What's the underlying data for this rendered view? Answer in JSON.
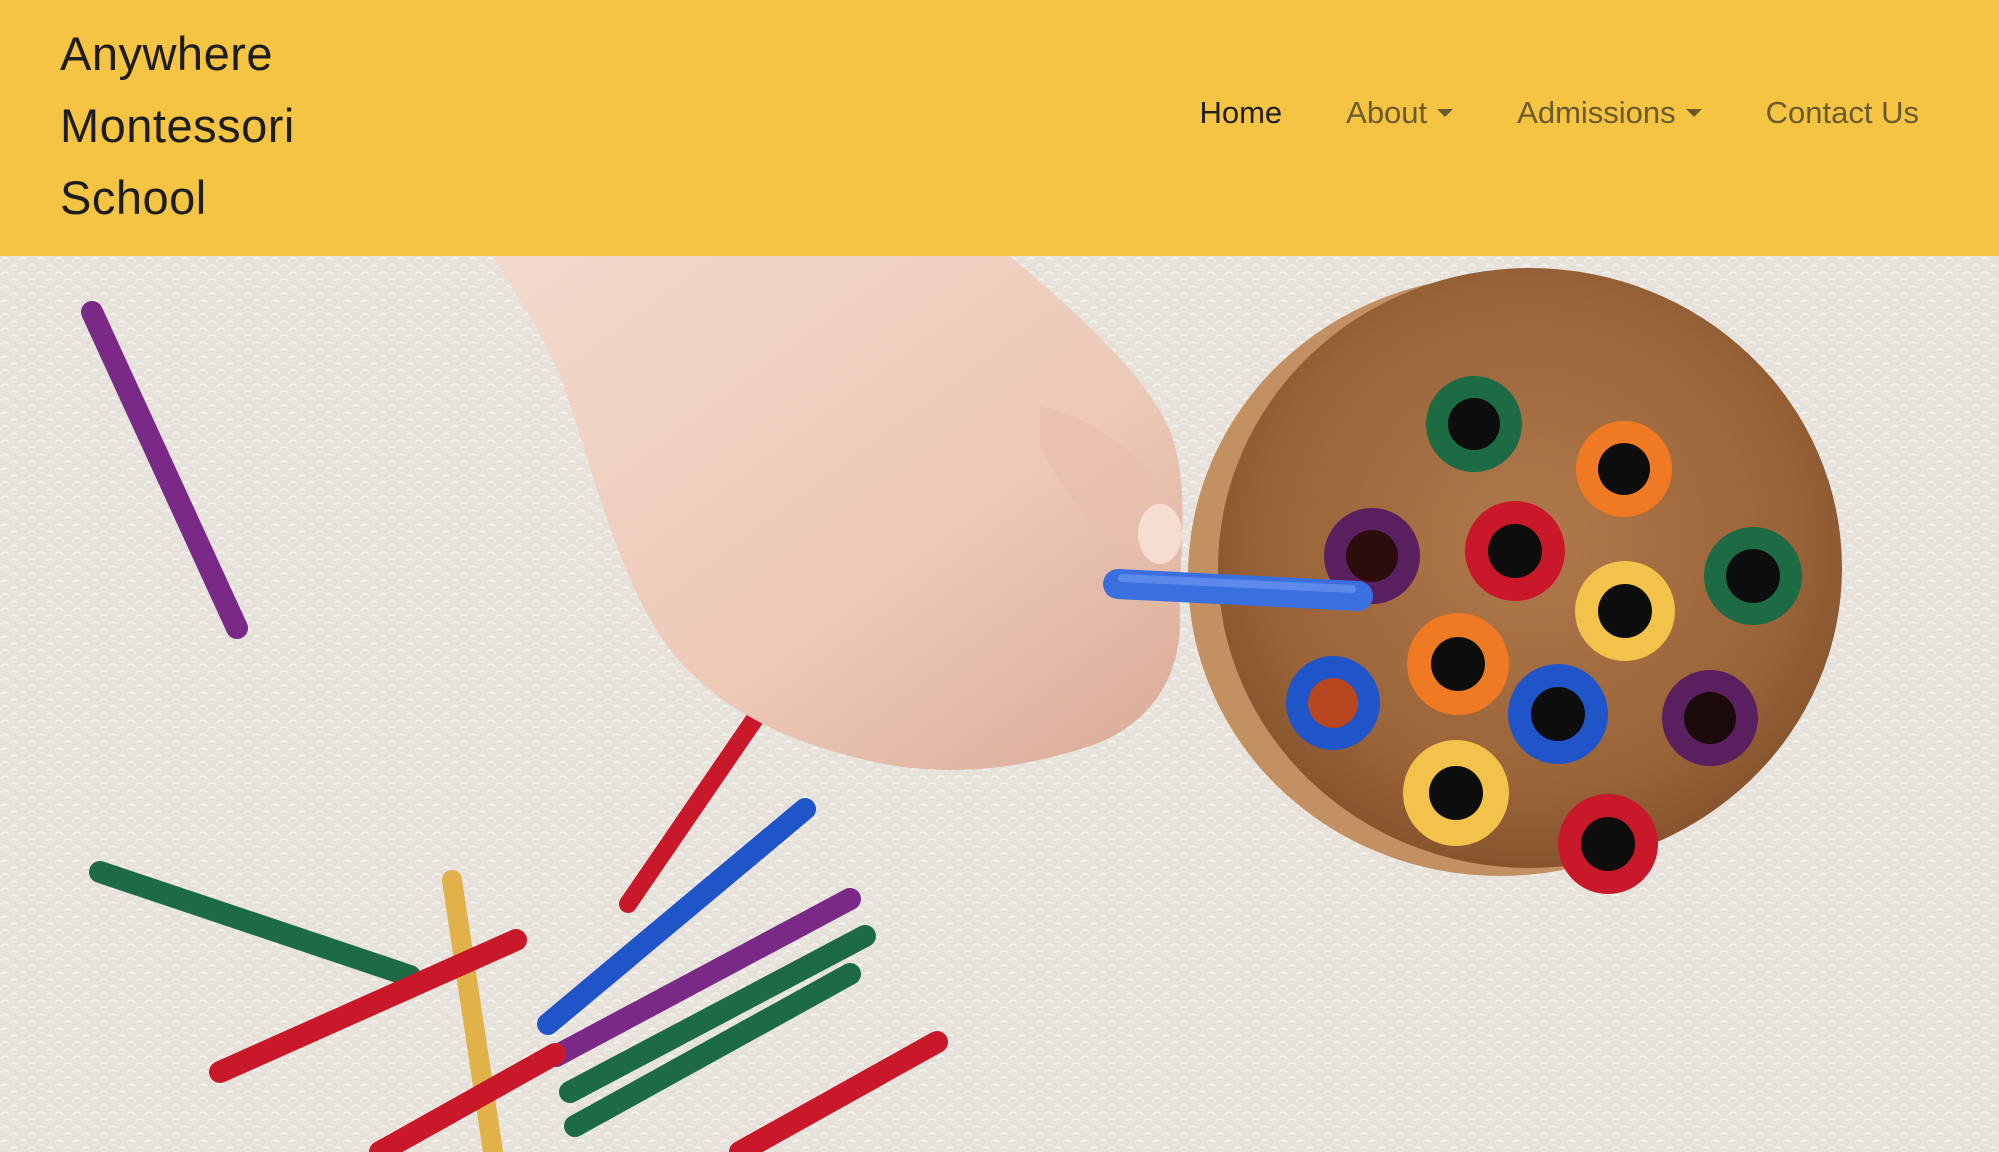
{
  "brand": {
    "lines": [
      "Anywhere",
      "Montessori",
      "School"
    ]
  },
  "nav": {
    "items": [
      {
        "label": "Home",
        "active": true,
        "dropdown": false
      },
      {
        "label": "About",
        "active": false,
        "dropdown": true
      },
      {
        "label": "Admissions",
        "active": false,
        "dropdown": true
      },
      {
        "label": "Contact Us",
        "active": false,
        "dropdown": false
      }
    ]
  },
  "colors": {
    "navbar_bg": "#f5c443",
    "nav_active": "#1f1f1f",
    "nav_inactive": "#6a5a2d",
    "rug": "#e7e3dc"
  }
}
